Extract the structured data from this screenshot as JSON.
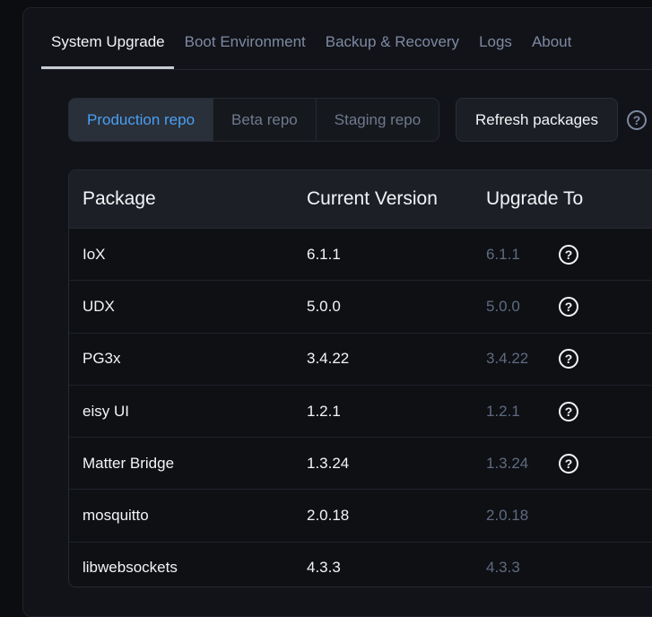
{
  "tabs": [
    {
      "label": "System Upgrade",
      "active": true
    },
    {
      "label": "Boot Environment",
      "active": false
    },
    {
      "label": "Backup & Recovery",
      "active": false
    },
    {
      "label": "Logs",
      "active": false
    },
    {
      "label": "About",
      "active": false
    }
  ],
  "repos": [
    {
      "label": "Production repo",
      "active": true
    },
    {
      "label": "Beta repo",
      "active": false
    },
    {
      "label": "Staging repo",
      "active": false
    }
  ],
  "refresh_label": "Refresh packages",
  "help_glyph": "?",
  "table": {
    "headers": [
      "Package",
      "Current Version",
      "Upgrade To"
    ],
    "rows": [
      {
        "package": "IoX",
        "current": "6.1.1",
        "upgrade": "6.1.1",
        "help": "?"
      },
      {
        "package": "UDX",
        "current": "5.0.0",
        "upgrade": "5.0.0",
        "help": "?"
      },
      {
        "package": "PG3x",
        "current": "3.4.22",
        "upgrade": "3.4.22",
        "help": "?"
      },
      {
        "package": "eisy UI",
        "current": "1.2.1",
        "upgrade": "1.2.1",
        "help": "?"
      },
      {
        "package": "Matter Bridge",
        "current": "1.3.24",
        "upgrade": "1.3.24",
        "help": "?"
      },
      {
        "package": "mosquitto",
        "current": "2.0.18",
        "upgrade": "2.0.18",
        "help": ""
      },
      {
        "package": "libwebsockets",
        "current": "4.3.3",
        "upgrade": "4.3.3",
        "help": ""
      }
    ]
  },
  "colors": {
    "accent": "#4a9ff5",
    "background": "#0b0d10",
    "muted_text": "#5f6b80"
  },
  "icons": {
    "help": "help-circle-icon"
  }
}
